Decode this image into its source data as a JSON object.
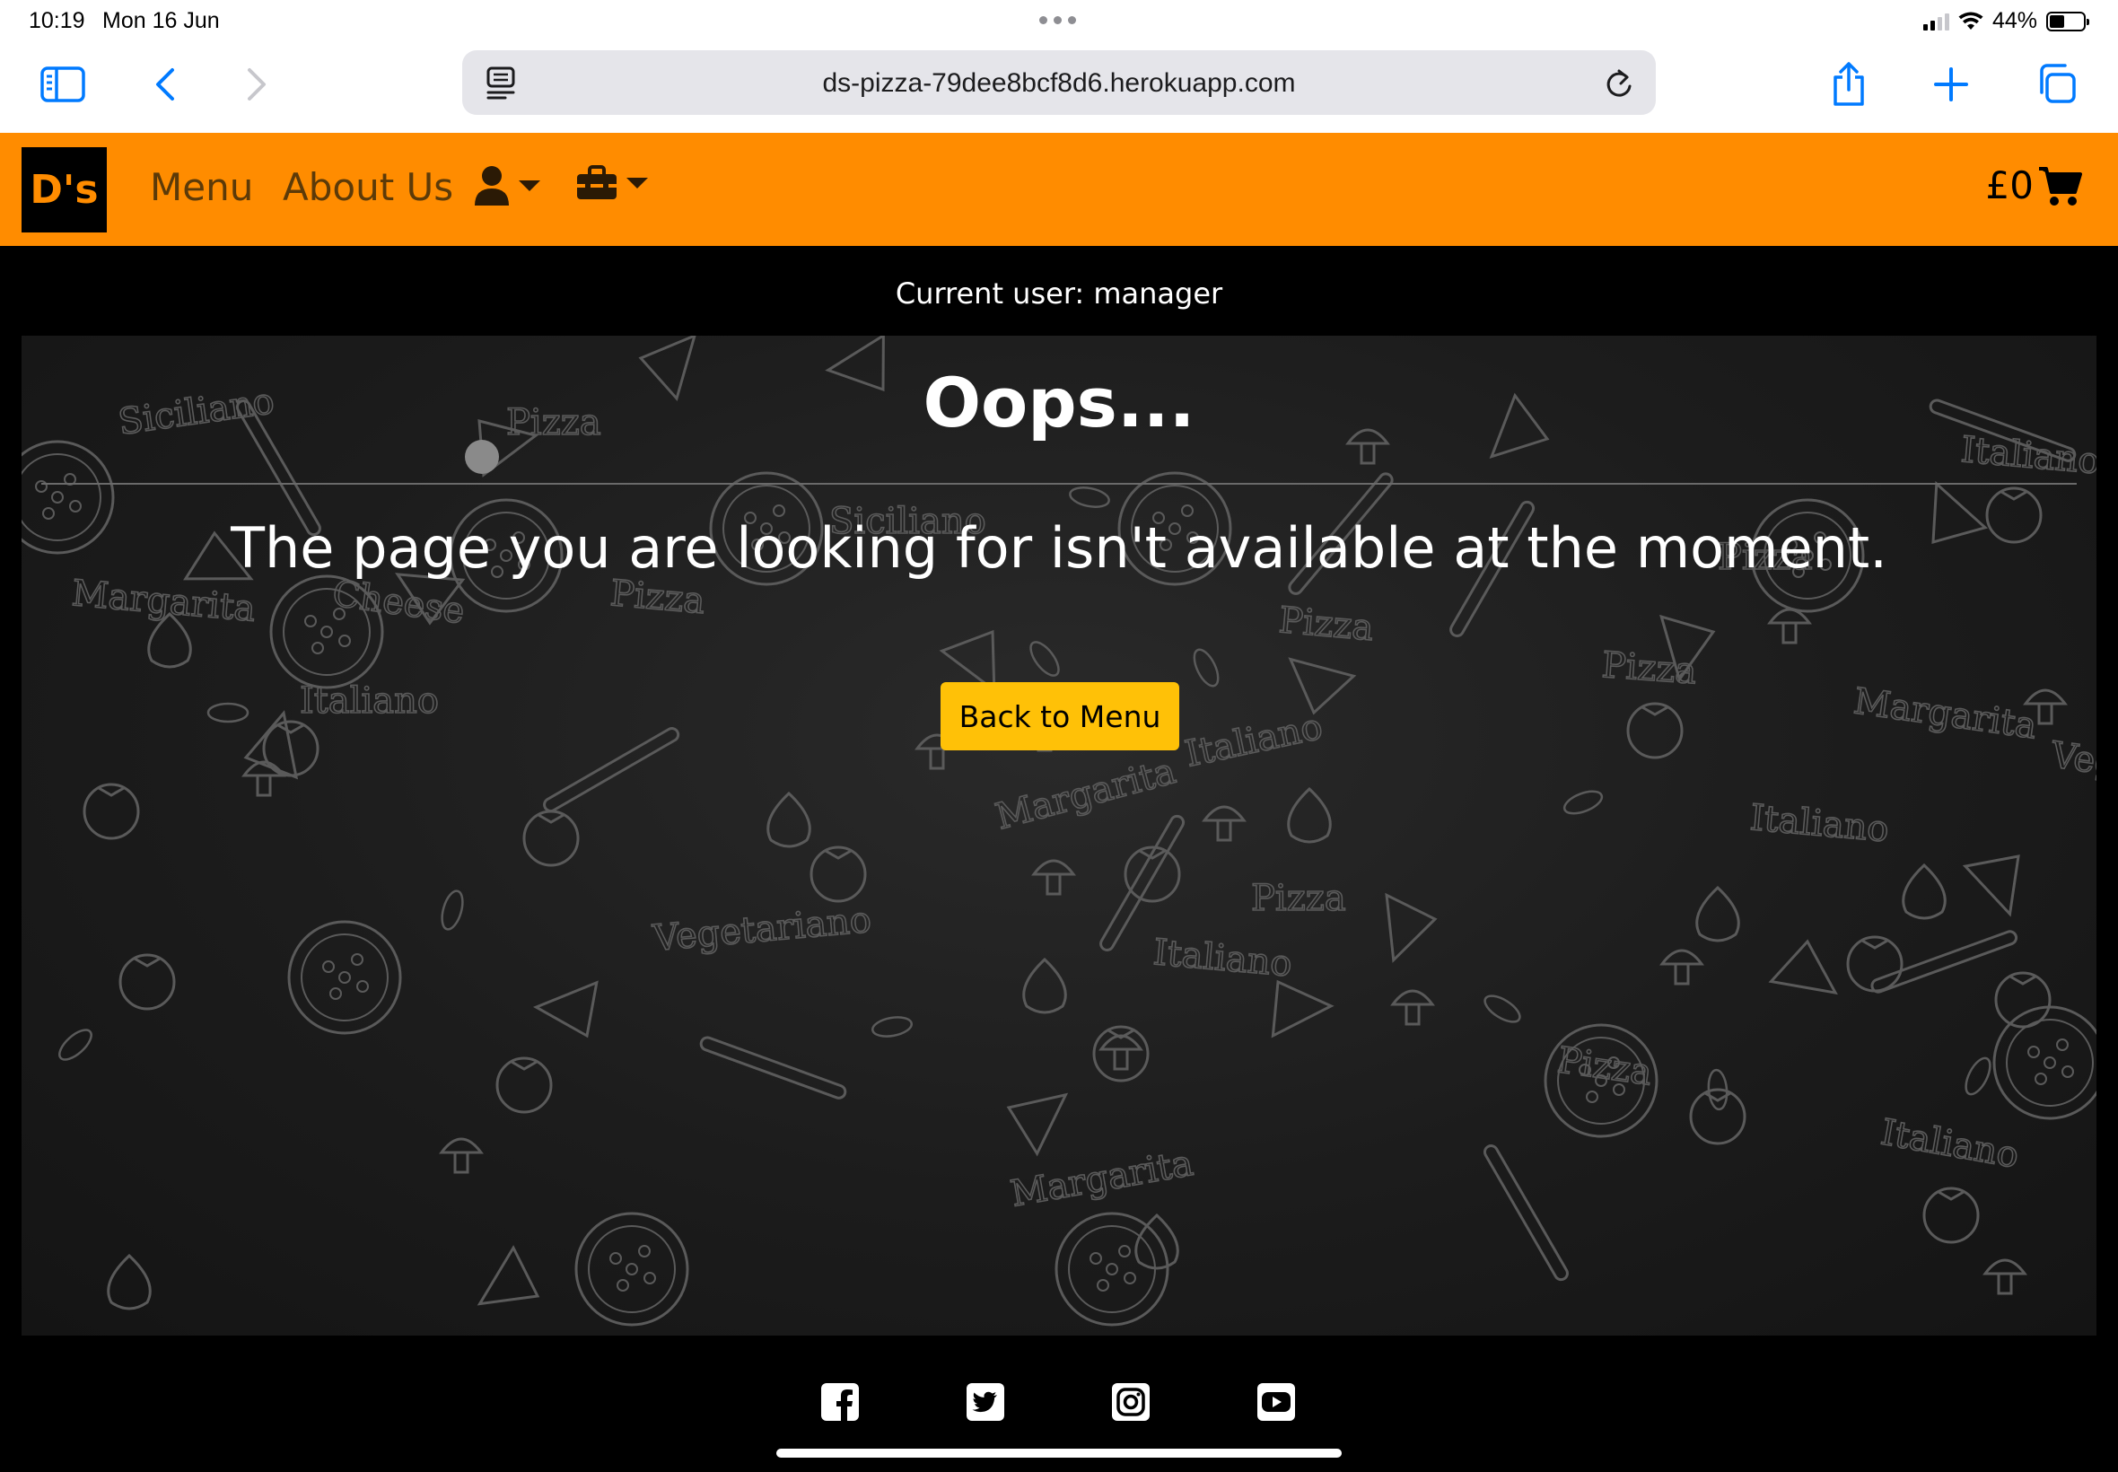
{
  "status_bar": {
    "time": "10:19",
    "date": "Mon 16 Jun",
    "battery": "44%",
    "battery_level": 0.44
  },
  "browser": {
    "url": "ds-pizza-79dee8bcf8d6.herokuapp.com",
    "icons": [
      "sidebar-icon",
      "back-icon",
      "forward-icon",
      "reader-icon",
      "reload-icon",
      "share-icon",
      "new-tab-icon",
      "tabs-icon"
    ]
  },
  "navbar": {
    "brand": "D's",
    "links": {
      "menu": "Menu",
      "about": "About Us"
    },
    "cart_total": "£0",
    "accent_color": "#ff8c00"
  },
  "current_user": "Current user: manager",
  "main": {
    "title": "Oops...",
    "message": "The page you are looking for isn't available at the moment.",
    "back_button": "Back to Menu",
    "button_color": "#ffc107",
    "background_words": [
      "Siciliano",
      "Pizza",
      "Margarita",
      "Cheese",
      "Italiano",
      "Vegetariano",
      "Siciliano",
      "Pizza",
      "Margarita",
      "Pizza",
      "Italiano",
      "Pizza",
      "Margarita",
      "Italiano",
      "Pizza",
      "Margarita",
      "Italiano",
      "Italiano",
      "Pizza",
      "Pizza",
      "Vege",
      "Italiano"
    ]
  },
  "footer": {
    "social": [
      "facebook-icon",
      "twitter-icon",
      "instagram-icon",
      "youtube-icon"
    ]
  }
}
